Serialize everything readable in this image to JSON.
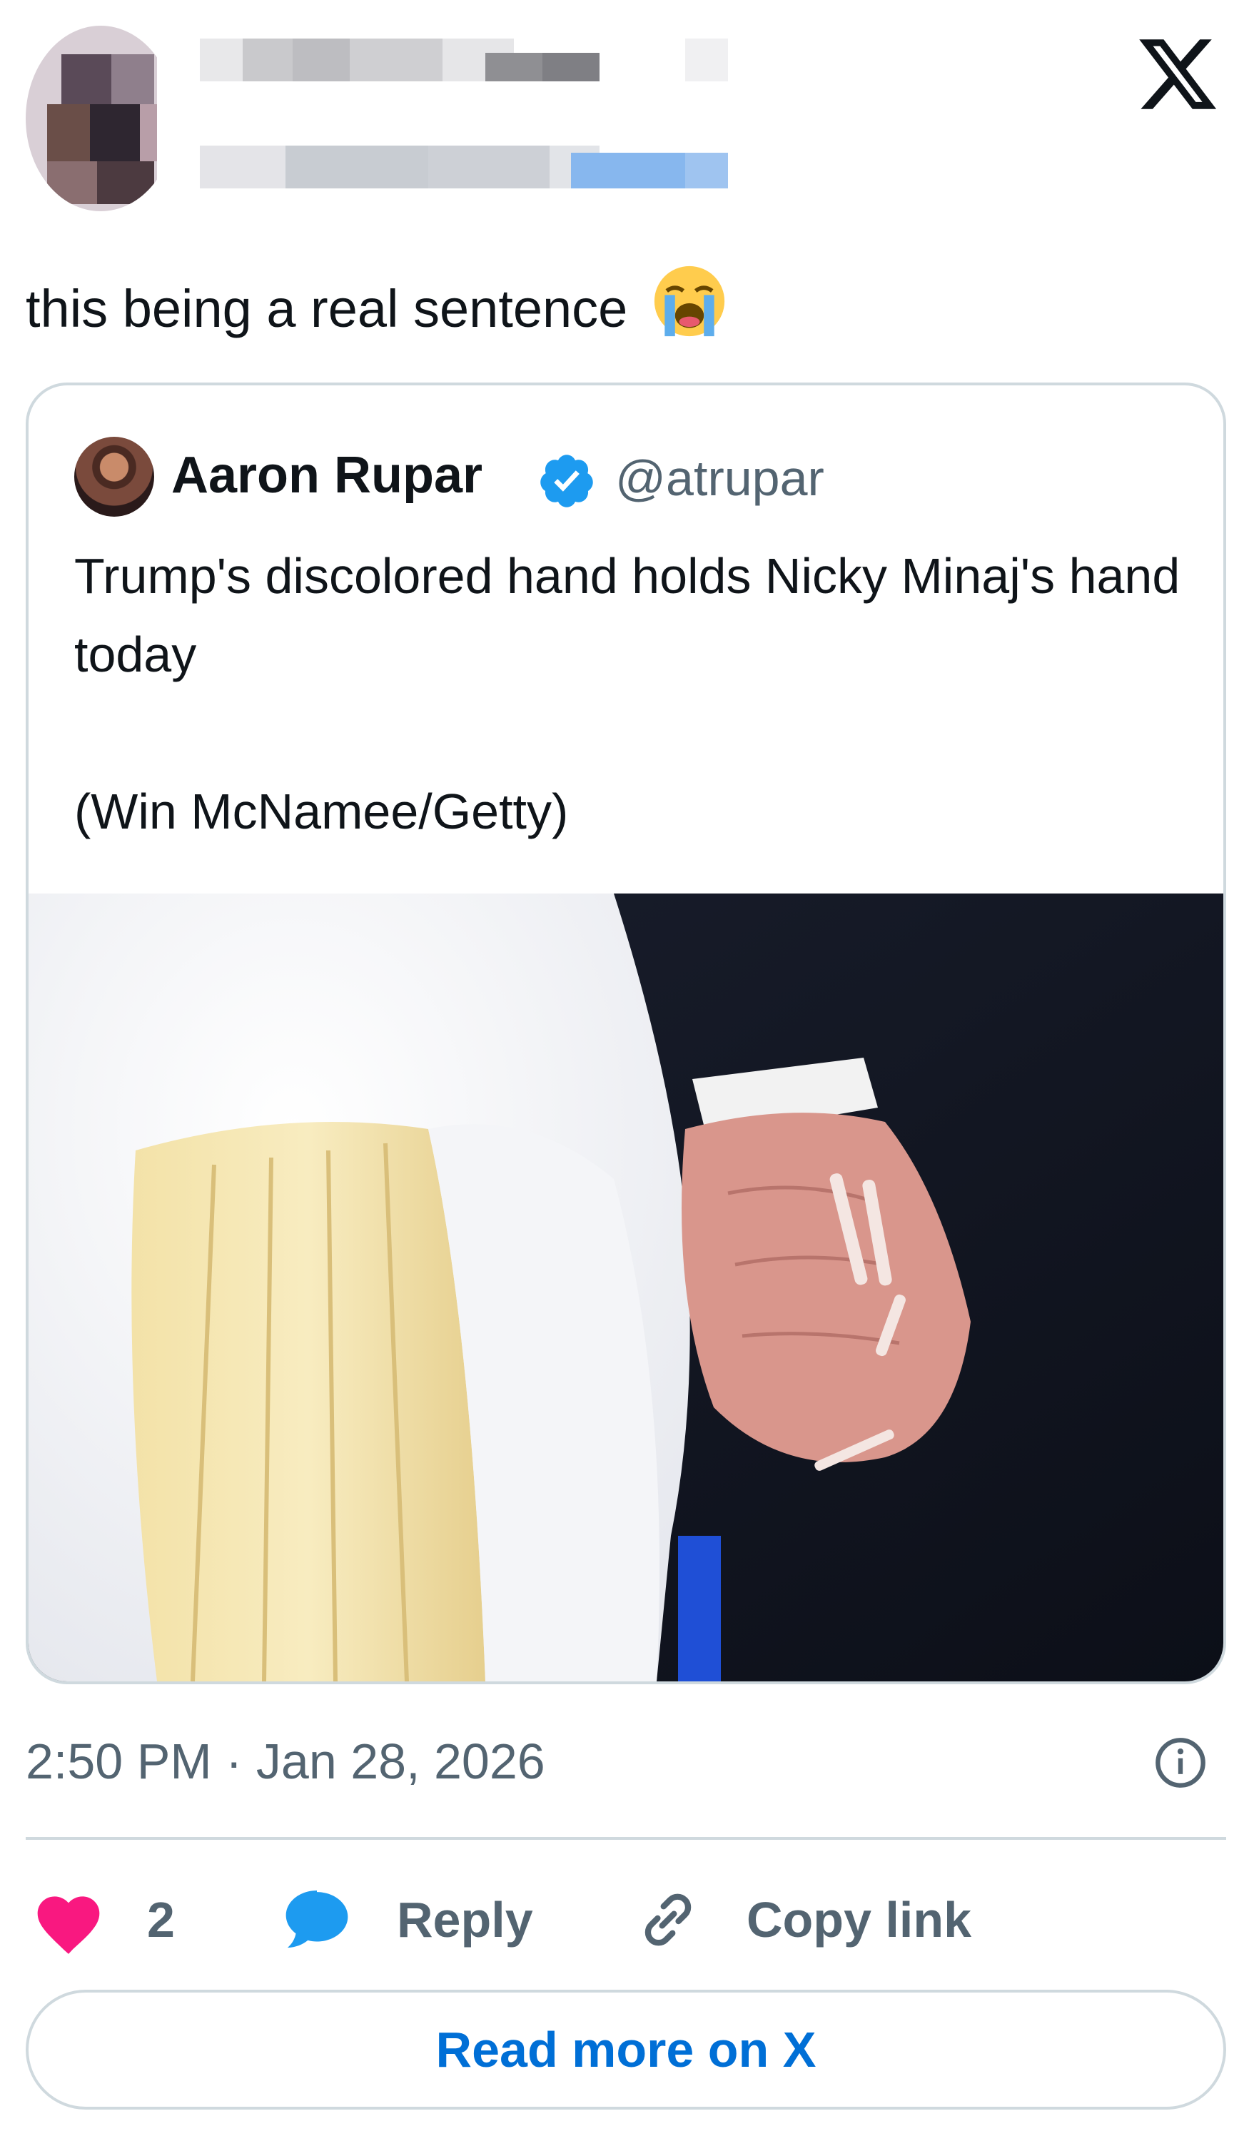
{
  "tweet": {
    "text": "this being a real sentence",
    "emoji": "loudly-crying-face"
  },
  "quoted": {
    "author_name": "Aaron Rupar",
    "handle": "@atrupar",
    "verified_icon": "verified-badge-icon",
    "text": "Trump's discolored hand holds Nicky Minaj's hand today\n\n(Win McNamee/Getty)"
  },
  "meta": {
    "timestamp": "2:50 PM · Jan 28, 2026"
  },
  "actions": {
    "like_count": "2",
    "reply_label": "Reply",
    "copy_link_label": "Copy link",
    "read_more_label": "Read more on X"
  },
  "colors": {
    "heart": "#f91880",
    "reply": "#1d9bf0",
    "verified": "#1d9bf0",
    "link_text": "#006fd6",
    "secondary_text": "#536471",
    "border": "#cfd9de"
  }
}
